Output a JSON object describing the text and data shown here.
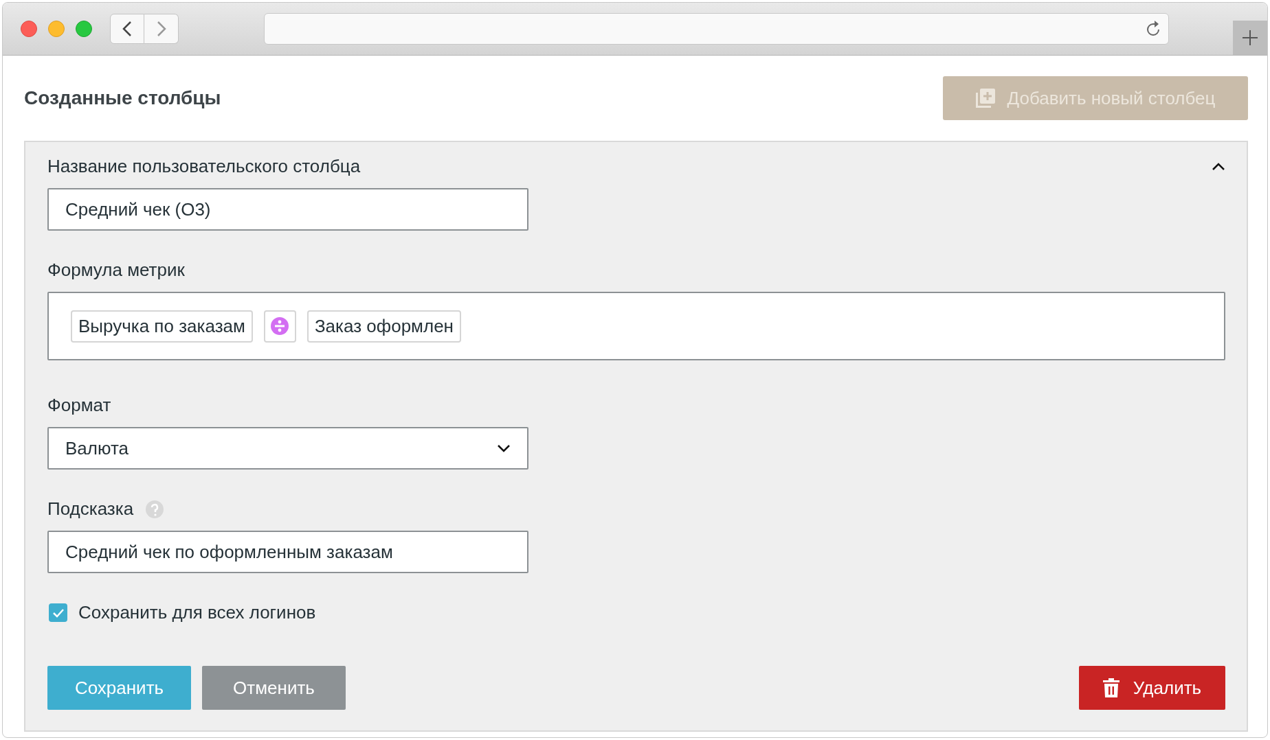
{
  "page": {
    "title": "Созданные столбцы",
    "add_button": {
      "label": "Добавить новый столбец",
      "disabled": true
    }
  },
  "panel": {
    "expanded": true,
    "name_field": {
      "label": "Название пользовательского столбца",
      "value": "Средний чек (О3)"
    },
    "formula": {
      "label": "Формула метрик",
      "tokens": [
        {
          "kind": "metric",
          "text": "Выручка по заказам"
        },
        {
          "kind": "divide"
        },
        {
          "kind": "metric",
          "text": "Заказ оформлен"
        }
      ]
    },
    "format_field": {
      "label": "Формат",
      "value": "Валюта"
    },
    "hint_field": {
      "label": "Подсказка",
      "value": "Средний чек по оформленным заказам"
    },
    "save_for_all": {
      "label": "Сохранить для всех логинов",
      "checked": true
    },
    "buttons": [
      {
        "kind": "primary",
        "label": "Сохранить"
      },
      {
        "kind": "secondary",
        "label": "Отменить"
      },
      {
        "kind": "danger",
        "label": "Удалить"
      }
    ]
  }
}
